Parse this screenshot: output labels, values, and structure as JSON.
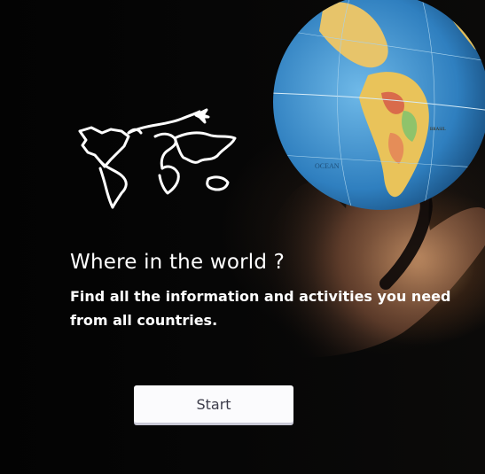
{
  "hero": {
    "title": "Where in the world ?",
    "subtitle": "Find all the information and activities you need from all countries.",
    "start_label": "Start",
    "globe_labels": {
      "ocean": "OCEAN",
      "country": "BRASIL"
    }
  },
  "icons": {
    "logo": "world-map-airplane-icon",
    "globe": "globe-image"
  },
  "colors": {
    "background": "#050505",
    "text": "#ffffff",
    "button_bg": "#fbfbfd",
    "button_text": "#3c3c4a",
    "ocean": "#3e8fcc",
    "land": "#e9c35a"
  }
}
